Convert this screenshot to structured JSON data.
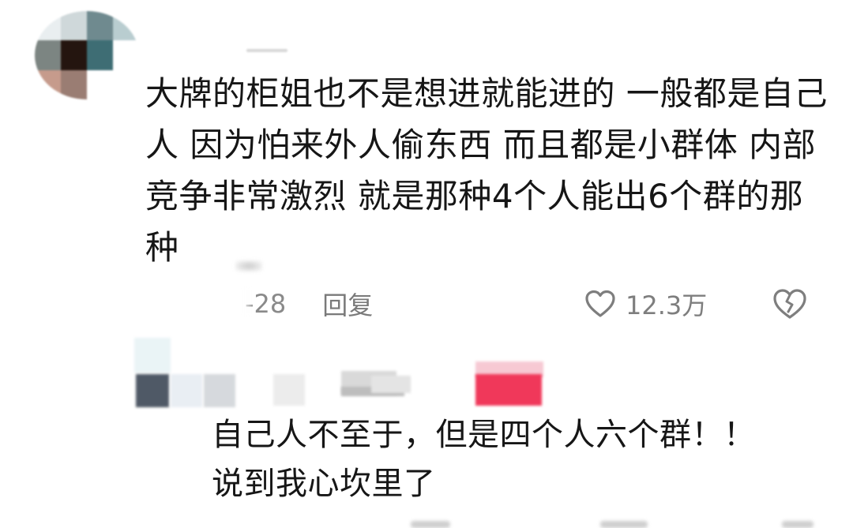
{
  "comment_1": {
    "text": "大牌的柜姐也不是想进就能进的 一般都是自己人 因为怕来外人偷东西 而且都是小群体 内部竞争非常激烈 就是那种4个人能出6个群的那种",
    "date_fragment": "-28",
    "reply_label": "回复",
    "like_count": "12.3万",
    "icons": {
      "like": "heart-outline-icon",
      "dislike": "broken-heart-icon"
    }
  },
  "comment_2": {
    "text_line_1": "自己人不至于，但是四个人六个群！！",
    "text_line_2": "说到我心坎里了"
  },
  "colors": {
    "text": "#161616",
    "meta": "#8a8a8a",
    "background": "#ffffff",
    "redacted_accent": "#f0385a"
  }
}
